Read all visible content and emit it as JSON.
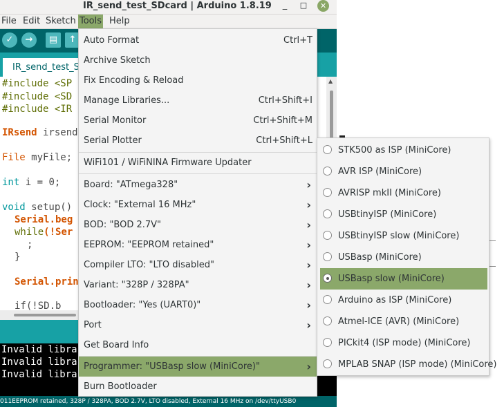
{
  "window": {
    "title": "IR_send_test_SDcard | Arduino 1.8.19",
    "minimize": "_",
    "maximize": "□",
    "close": "✕"
  },
  "menubar": {
    "file": "File",
    "edit": "Edit",
    "sketch": "Sketch",
    "tools": "Tools",
    "help": "Help"
  },
  "toolbar": {
    "verify_icon": "✓",
    "upload_icon": "→",
    "new_icon": "▤",
    "open_icon": "↑"
  },
  "tab": {
    "label": "IR_send_test_SDcard"
  },
  "editor": {
    "include1": "#include <SP",
    "include2": "#include <SD",
    "include3": "#include <IR",
    "irsend_type": "IRsend",
    "irsend_rest": " irsend",
    "file_type": "File",
    "file_rest": " myFile;",
    "int_type": "int",
    "int_rest": " i = 0;",
    "void_type": "void",
    "void_rest": " setup()",
    "serial_begin": "Serial.beg",
    "while_kw": "while",
    "while_rest": "(!Ser",
    "semicolon": ";",
    "brace": "}",
    "serial_print": "Serial.prin",
    "if_line": "if(!SD.b"
  },
  "console": {
    "line1": "Invalid libra",
    "line2": "Invalid libra",
    "line3": "Invalid libra"
  },
  "statusbar": {
    "text": "011EEPROM retained, 328P / 328PA, BOD 2.7V, LTO disabled, External 16 MHz on /dev/ttyUSB0"
  },
  "tools_menu": {
    "auto_format": "Auto Format",
    "auto_format_acc": "Ctrl+T",
    "archive_sketch": "Archive Sketch",
    "fix_encoding": "Fix Encoding & Reload",
    "manage_libraries": "Manage Libraries...",
    "manage_libraries_acc": "Ctrl+Shift+I",
    "serial_monitor": "Serial Monitor",
    "serial_monitor_acc": "Ctrl+Shift+M",
    "serial_plotter": "Serial Plotter",
    "serial_plotter_acc": "Ctrl+Shift+L",
    "wifi_updater": "WiFi101 / WiFiNINA Firmware Updater",
    "board": "Board: \"ATmega328\"",
    "clock": "Clock: \"External 16 MHz\"",
    "bod": "BOD: \"BOD 2.7V\"",
    "eeprom": "EEPROM: \"EEPROM retained\"",
    "compiler_lto": "Compiler LTO: \"LTO disabled\"",
    "variant": "Variant: \"328P / 328PA\"",
    "bootloader": "Bootloader: \"Yes (UART0)\"",
    "port": "Port",
    "get_board_info": "Get Board Info",
    "programmer": "Programmer: \"USBasp slow (MiniCore)\"",
    "burn_bootloader": "Burn Bootloader",
    "arrow": "›"
  },
  "programmer_submenu": {
    "items": [
      "STK500 as ISP (MiniCore)",
      "AVR ISP (MiniCore)",
      "AVRISP mkII (MiniCore)",
      "USBtinyISP (MiniCore)",
      "USBtinyISP slow (MiniCore)",
      "USBasp (MiniCore)",
      "USBasp slow (MiniCore)",
      "Arduino as ISP (MiniCore)",
      "Atmel-ICE (AVR) (MiniCore)",
      "PICkit4 (ISP mode) (MiniCore)",
      "MPLAB SNAP (ISP mode) (MiniCore)"
    ],
    "selected": "USBasp slow (MiniCore)"
  },
  "colors": {
    "highlight": "#8ba86a",
    "toolbar": "#006468",
    "tabbar": "#17a1a5"
  }
}
